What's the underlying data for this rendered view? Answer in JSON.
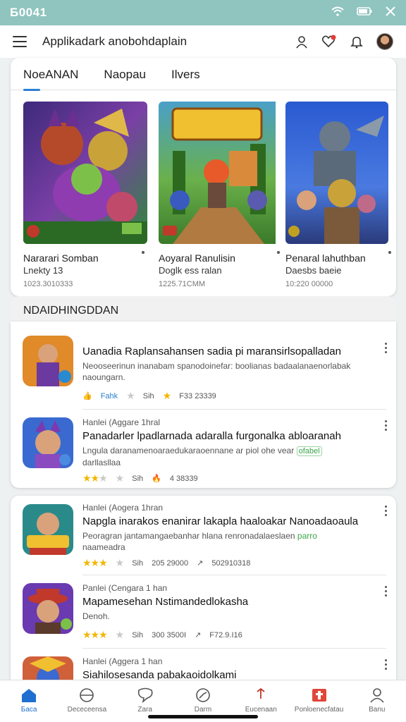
{
  "status_bar": {
    "time": "Б0041"
  },
  "appbar": {
    "title": "Applikadark anobohdaplain"
  },
  "tabs": [
    {
      "label": "NoeANAN",
      "active": true
    },
    {
      "label": "Naopau",
      "active": false
    },
    {
      "label": "Ilvers",
      "active": false
    }
  ],
  "featured": [
    {
      "name": "Nararari Somban",
      "sub": "Lnekty 13",
      "meta": "1023.3010333"
    },
    {
      "name": "Aoyaral Ranulisin",
      "sub": "Doglk ess ralan",
      "meta": "1225.71CMM"
    },
    {
      "name": "Penaral lahuthban",
      "sub": "Daesbs baeie",
      "meta": "10:220 00000"
    }
  ],
  "section": {
    "title": "NDAIDHINGDDAN"
  },
  "list1": [
    {
      "kicker": "",
      "title": "Uanadia Raplansahansen sadia pi maransirlsopalladan",
      "desc": "Neooseerinun inanabam spanodoinefar: boolianas badaalanaenorlabak naoungarn.",
      "tag": "",
      "rating_label": "Fahk",
      "size": "Sih",
      "downloads": "F33 23339",
      "stars": 0
    },
    {
      "kicker": "Hanlei (Aggare 1hral",
      "title": "Panadarler lpadlarnada adaralla furgonalka abloaranah",
      "desc": "Lngula daranamenoaraedukaraoennane ar piol ohe vear",
      "tag": "ofabel",
      "desc2": "darllasllaa",
      "rating_label": "",
      "size": "Sih",
      "downloads": "4 38339",
      "stars": 2
    }
  ],
  "list2": [
    {
      "kicker": "Hanlei (Aogera 1hran",
      "title": "Napgla inarakos enanirar lakapla haaloakar Nanoadaoaula",
      "desc": "Peoragran jantamangaebanhar hlana renronadalaeslaen",
      "tag": "parro",
      "desc2": "naameadra",
      "size": "Sih",
      "downloads": "205 29000",
      "extra": "502910318",
      "stars": 3
    },
    {
      "kicker": "Panlei (Cengara 1 han",
      "title": "Mapamesehan Nstimandedlokasha",
      "desc": "Denoh.",
      "tag": "",
      "desc2": "",
      "size": "Sih",
      "downloads": "300 3500I",
      "extra": "F72.9.I16",
      "stars": 3
    },
    {
      "kicker": "Hanlei (Aggera 1 han",
      "title": "Siahilosesanda pabakaoidolkami",
      "desc": "",
      "tag": "",
      "desc2": "",
      "size": "",
      "downloads": "",
      "extra": "",
      "stars": 0
    }
  ],
  "bottom_nav": [
    {
      "label": "Баca",
      "icon": "home-icon",
      "active": true
    },
    {
      "label": "Dececeensa",
      "icon": "globe-icon",
      "active": false
    },
    {
      "label": "Zara",
      "icon": "chat-icon",
      "active": false
    },
    {
      "label": "Darm",
      "icon": "compass-icon",
      "active": false
    },
    {
      "label": "Eucenaan",
      "icon": "bell-icon",
      "active": false
    },
    {
      "label": "Ponloenecfatau",
      "icon": "gift-icon",
      "active": false
    },
    {
      "label": "Banu",
      "icon": "person-icon",
      "active": false
    }
  ],
  "colors": {
    "status_bar": "#8fc4bf",
    "accent": "#1f6fd0",
    "star": "#f2b600",
    "tag": "#3aa64a"
  }
}
